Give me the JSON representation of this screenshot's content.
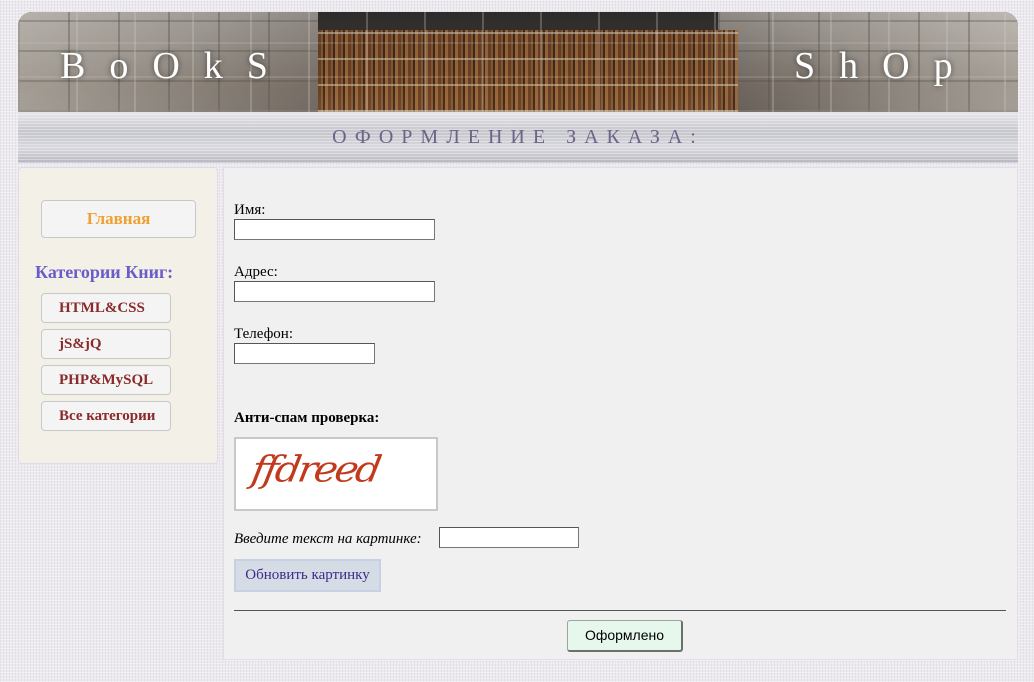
{
  "header": {
    "logo_left": "BoOkS",
    "logo_right": "ShOp",
    "page_heading": "ОФОРМЛЕНИЕ ЗАКАЗА:"
  },
  "sidebar": {
    "home_label": "Главная",
    "categories_title": "Категории Книг:",
    "categories": [
      {
        "label": "HTML&CSS"
      },
      {
        "label": "jS&jQ"
      },
      {
        "label": "PHP&MySQL"
      },
      {
        "label": "Все категории"
      }
    ]
  },
  "form": {
    "name_label": "Имя:",
    "name_value": "",
    "address_label": "Адрес:",
    "address_value": "",
    "phone_label": "Телефон:",
    "phone_value": "",
    "antispam_label": "Анти-спам проверка:",
    "captcha_image_text": "ffdreed",
    "captcha_prompt": "Введите текст на картинке:",
    "captcha_value": "",
    "refresh_label": "Обновить картинку",
    "submit_label": "Оформлено"
  },
  "colors": {
    "home_link": "#f0a030",
    "category_title": "#6a5cc9",
    "category_link": "#8a2a2a",
    "captcha_text": "#c23a1e",
    "heading": "#6e6288"
  }
}
